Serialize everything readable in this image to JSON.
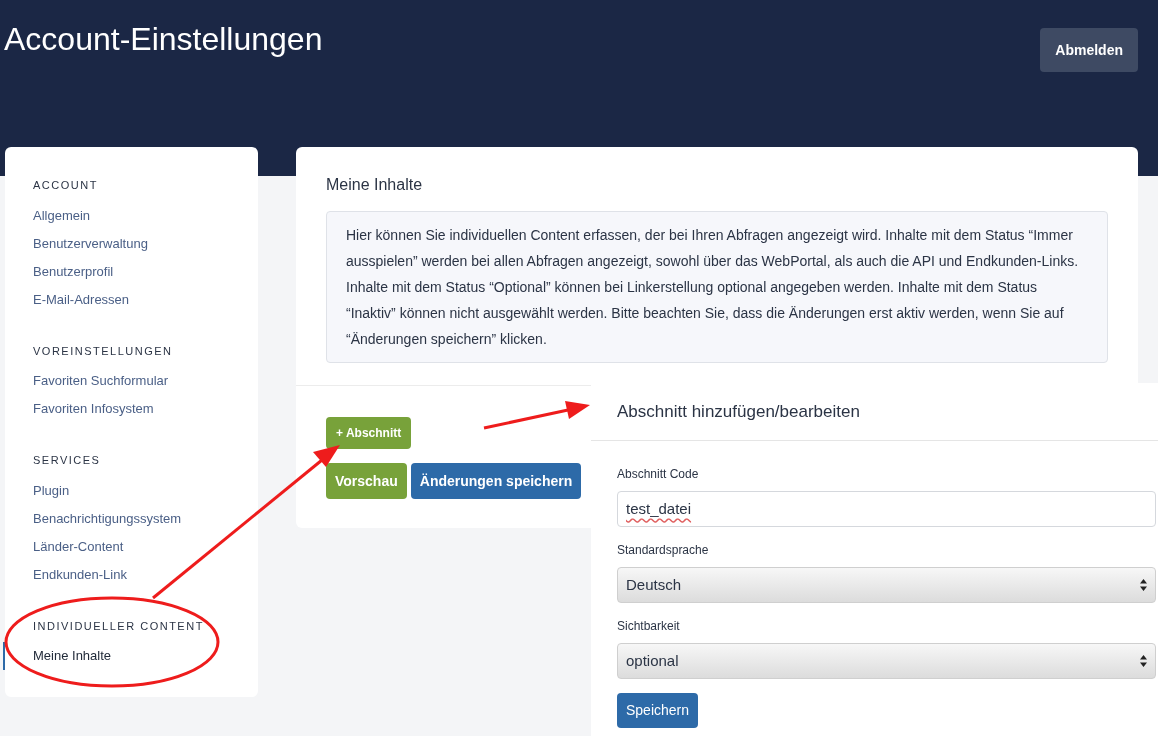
{
  "header": {
    "title": "Account-Einstellungen",
    "logout_button": "Abmelden"
  },
  "sidebar": {
    "sections": [
      {
        "heading": "ACCOUNT",
        "items": [
          {
            "label": "Allgemein",
            "selected": false
          },
          {
            "label": "Benutzerverwaltung",
            "selected": false
          },
          {
            "label": "Benutzerprofil",
            "selected": false
          },
          {
            "label": "E-Mail-Adressen",
            "selected": false
          }
        ]
      },
      {
        "heading": "VOREINSTELLUNGEN",
        "items": [
          {
            "label": "Favoriten Suchformular",
            "selected": false
          },
          {
            "label": "Favoriten Infosystem",
            "selected": false
          }
        ]
      },
      {
        "heading": "SERVICES",
        "items": [
          {
            "label": "Plugin",
            "selected": false
          },
          {
            "label": "Benachrichtigungssystem",
            "selected": false
          },
          {
            "label": "Länder-Content",
            "selected": false
          },
          {
            "label": "Endkunden-Link",
            "selected": false
          }
        ]
      },
      {
        "heading": "INDIVIDUELLER CONTENT",
        "items": [
          {
            "label": "Meine Inhalte",
            "selected": true
          }
        ]
      }
    ]
  },
  "main": {
    "title": "Meine Inhalte",
    "info": "Hier können Sie individuellen Content erfassen, der bei Ihren Abfragen angezeigt wird. Inhalte mit dem Status “Immer ausspielen” werden bei allen Abfragen angezeigt, sowohl über das WebPortal, als auch die API und Endkunden-Links. Inhalte mit dem Status “Optional” können bei Linkerstellung optional angegeben werden. Inhalte mit dem Status “Inaktiv” können nicht ausgewählt werden. Bitte beachten Sie, dass die Änderungen erst aktiv werden, wenn Sie auf “Änderungen speichern” klicken.",
    "add_button": "+ Abschnitt",
    "preview_button": "Vorschau",
    "save_changes_button": "Änderungen speichern"
  },
  "panel": {
    "title": "Abschnitt hinzufügen/bearbeiten",
    "fields": [
      {
        "kind": "text",
        "label": "Abschnitt Code",
        "value": "test_datei"
      },
      {
        "kind": "select",
        "label": "Standardsprache",
        "value": "Deutsch"
      },
      {
        "kind": "select",
        "label": "Sichtbarkeit",
        "value": "optional"
      }
    ],
    "save_button": "Speichern"
  }
}
